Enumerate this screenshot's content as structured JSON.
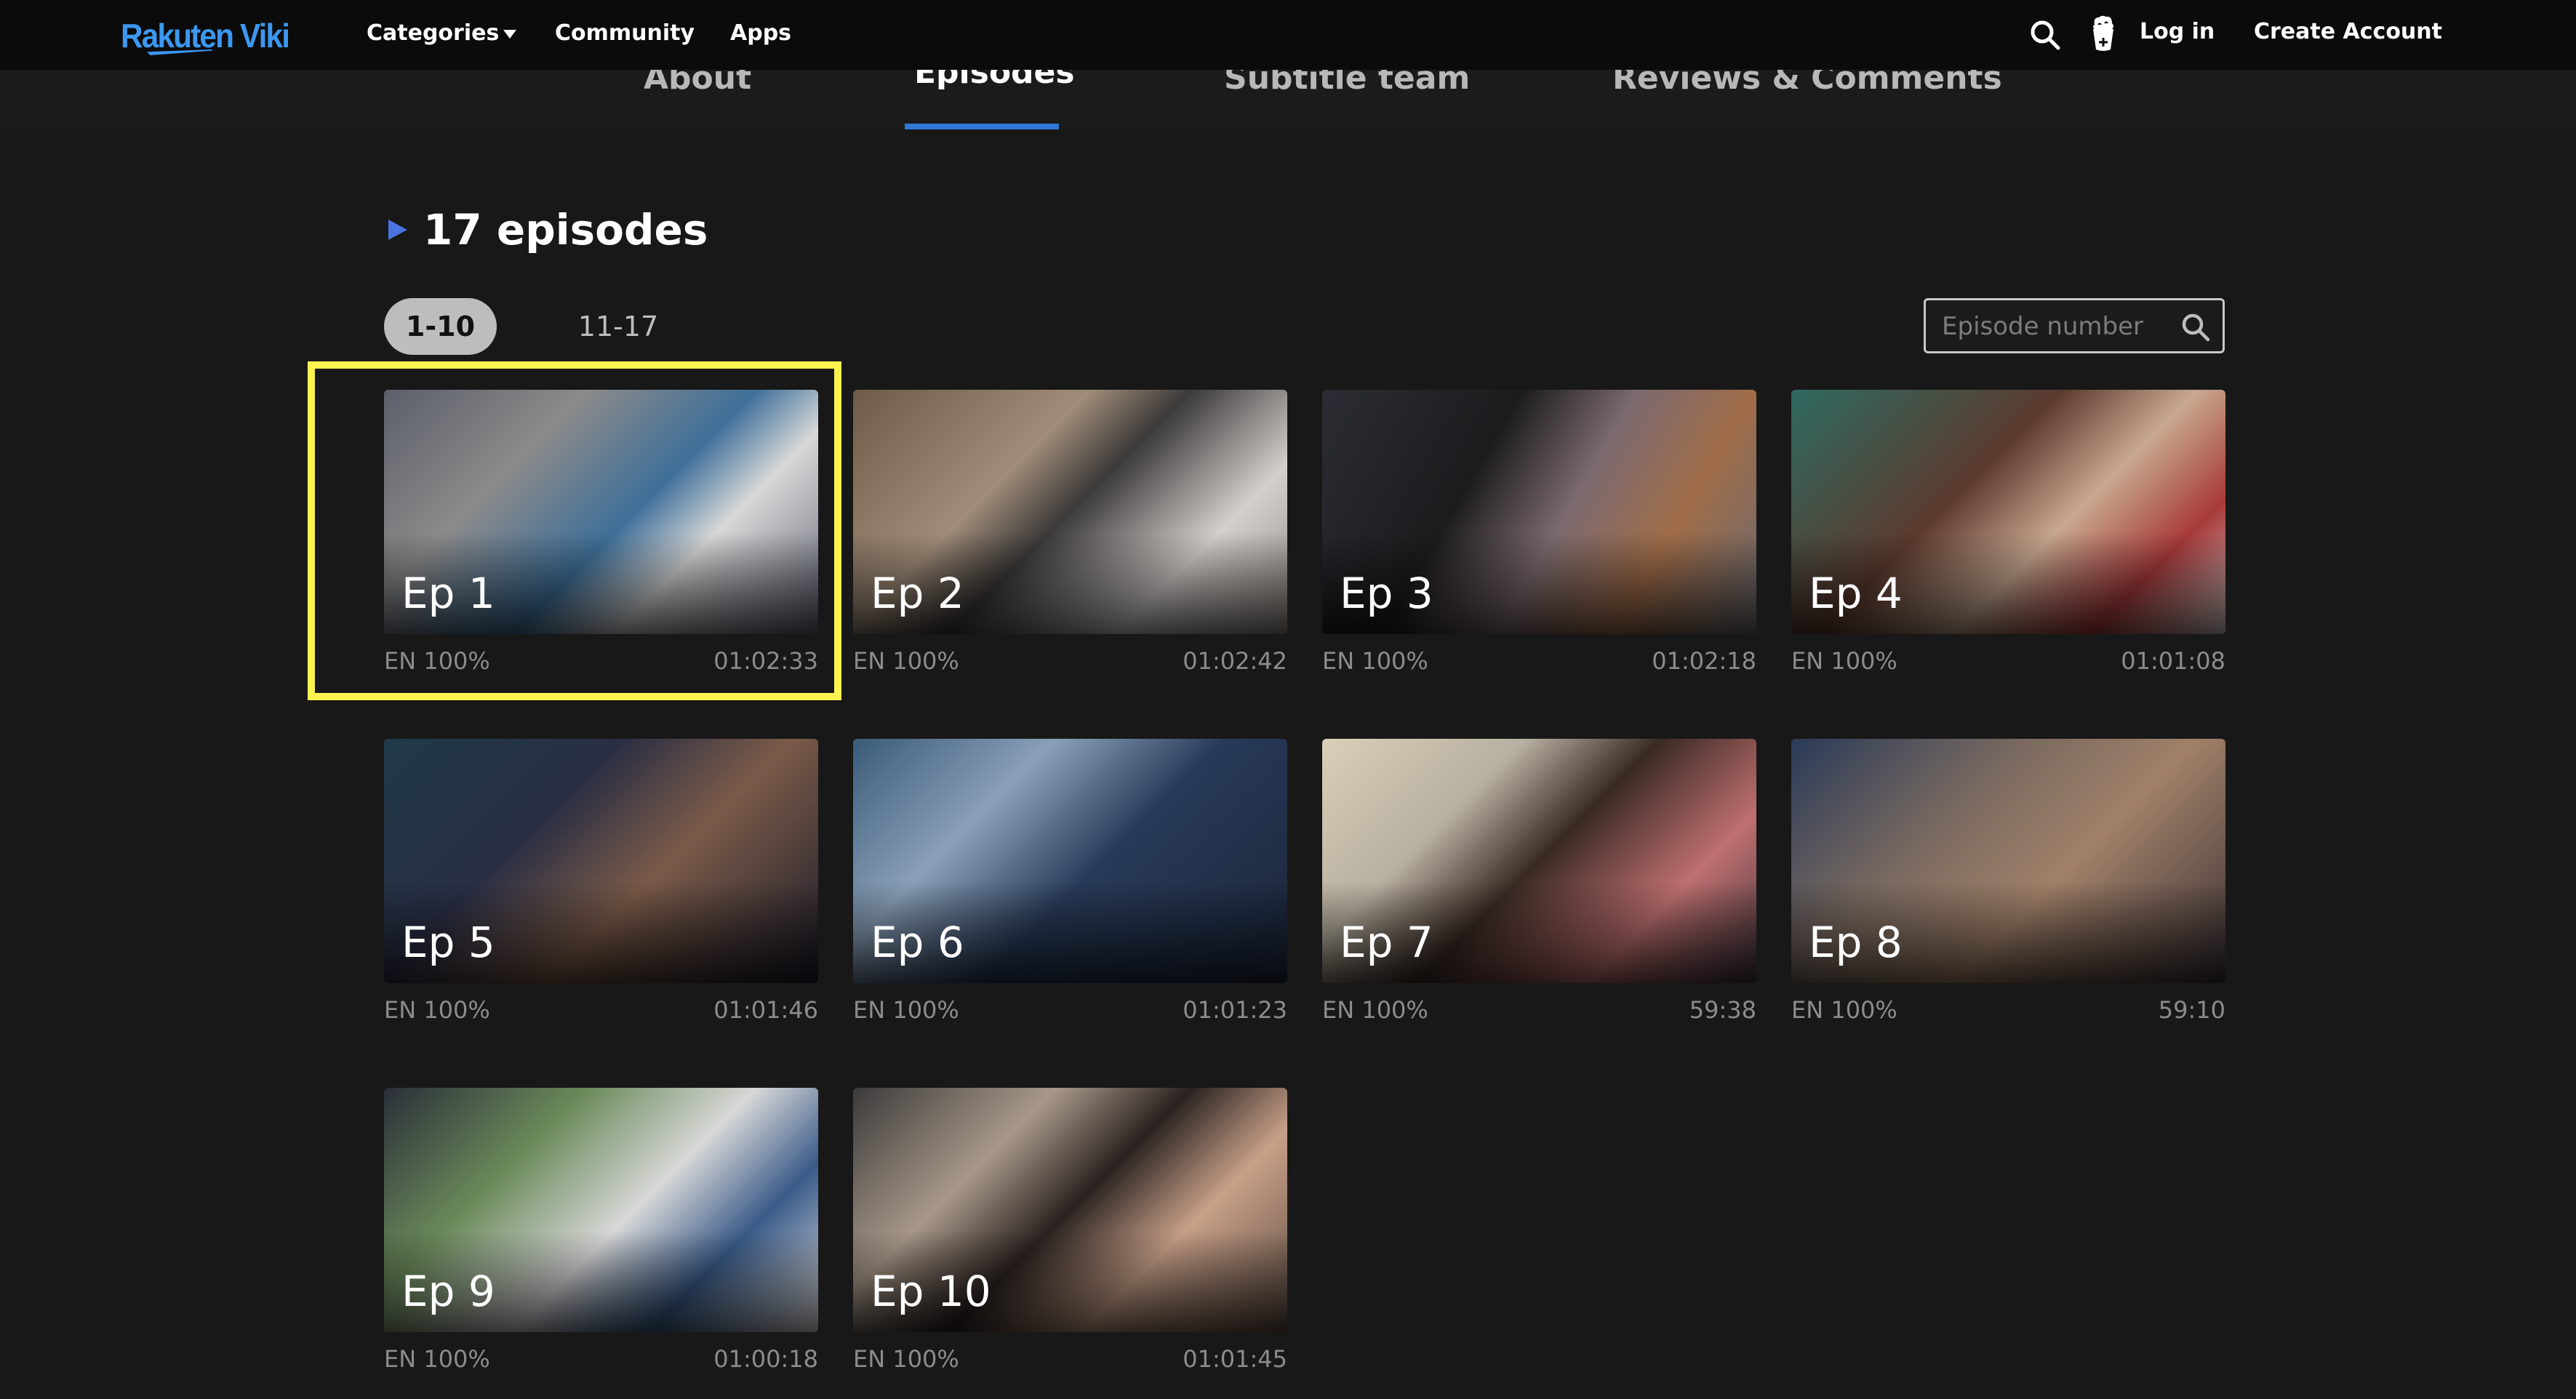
{
  "header": {
    "logo": "Rakuten Viki",
    "nav": {
      "categories": "Categories",
      "community": "Community",
      "apps": "Apps"
    },
    "icons": {
      "search": "search-icon",
      "avatar": "popcorn-avatar-icon"
    },
    "login": "Log in",
    "create_account": "Create Account"
  },
  "subnav": {
    "tabs": [
      {
        "label": "About",
        "active": false
      },
      {
        "label": "Episodes",
        "active": true
      },
      {
        "label": "Subtitle team",
        "active": false
      },
      {
        "label": "Reviews & Comments",
        "active": false
      }
    ]
  },
  "episodes": {
    "title": "17 episodes",
    "pages": [
      {
        "label": "1-10",
        "active": true
      },
      {
        "label": "11-17",
        "active": false
      }
    ],
    "search_placeholder": "Episode number",
    "items": [
      {
        "label": "Ep 1",
        "subtitle": "EN 100%",
        "duration": "01:02:33",
        "highlighted": true
      },
      {
        "label": "Ep 2",
        "subtitle": "EN 100%",
        "duration": "01:02:42"
      },
      {
        "label": "Ep 3",
        "subtitle": "EN 100%",
        "duration": "01:02:18"
      },
      {
        "label": "Ep 4",
        "subtitle": "EN 100%",
        "duration": "01:01:08"
      },
      {
        "label": "Ep 5",
        "subtitle": "EN 100%",
        "duration": "01:01:46"
      },
      {
        "label": "Ep 6",
        "subtitle": "EN 100%",
        "duration": "01:01:23"
      },
      {
        "label": "Ep 7",
        "subtitle": "EN 100%",
        "duration": "59:38"
      },
      {
        "label": "Ep 8",
        "subtitle": "EN 100%",
        "duration": "59:10"
      },
      {
        "label": "Ep 9",
        "subtitle": "EN 100%",
        "duration": "01:00:18"
      },
      {
        "label": "Ep 10",
        "subtitle": "EN 100%",
        "duration": "01:01:45"
      }
    ]
  },
  "colors": {
    "brand": "#3c97f0",
    "active_tab_underline": "#2f78d6",
    "highlight": "#fbf34f"
  }
}
